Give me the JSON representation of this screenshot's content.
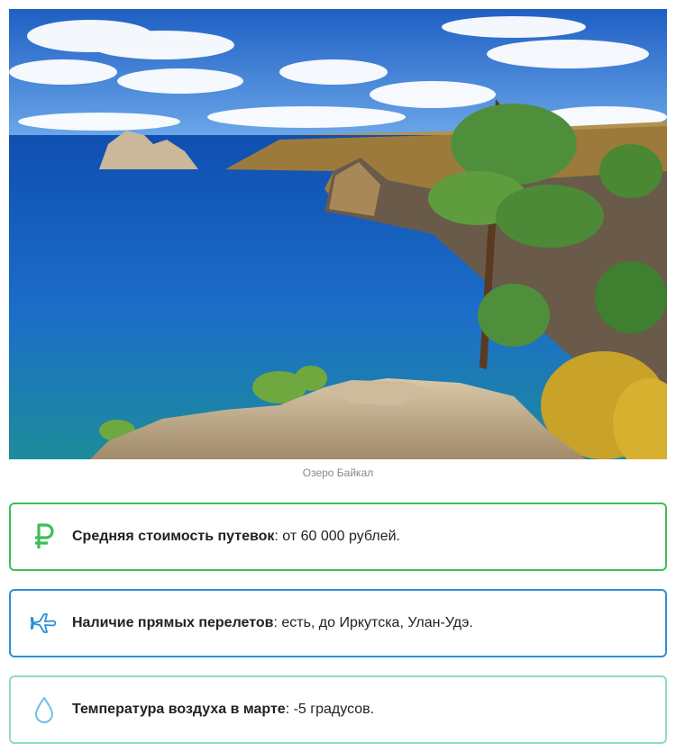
{
  "photo": {
    "alt": "Озеро Байкал"
  },
  "caption": "Озеро Байкал",
  "cards": [
    {
      "icon": "ruble-icon",
      "label": "Средняя стоимость путевок",
      "separator": ":",
      "value": " от 60 000 рублей.",
      "border_color": "#3bbf5a",
      "icon_color": "#3bbf5a"
    },
    {
      "icon": "airplane-icon",
      "label": "Наличие прямых перелетов",
      "separator": ":",
      "value": " есть, до Иркутска, Улан-Удэ.",
      "border_color": "#2a8fd8",
      "icon_color": "#2a8fd8"
    },
    {
      "icon": "water-drop-icon",
      "label": "Температура воздуха в марте",
      "separator": ":",
      "value": " -5 градусов.",
      "border_color": "#8fdcc0",
      "icon_color": "#6cc0ee"
    }
  ]
}
